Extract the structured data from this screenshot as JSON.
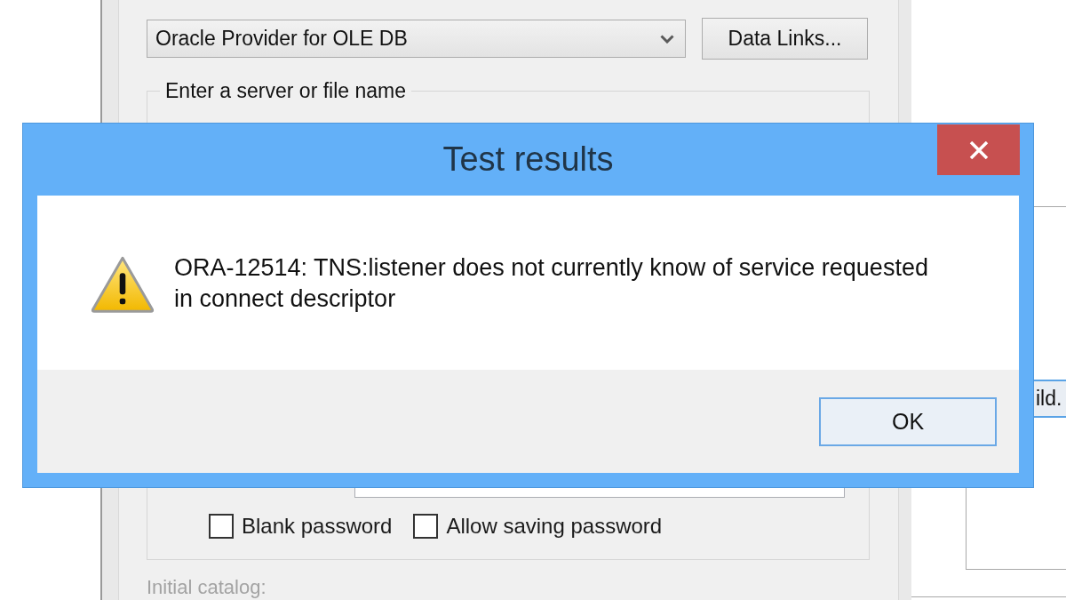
{
  "background_window": {
    "provider_combo": {
      "value": "Oracle Provider for OLE DB"
    },
    "data_links_button": {
      "label": "Data Links..."
    },
    "server_group": {
      "label": "Enter a server or file name"
    },
    "checkboxes": [
      {
        "label": "Blank password",
        "checked": false
      },
      {
        "label": "Allow saving password",
        "checked": false
      }
    ],
    "initial_catalog": {
      "label": "Initial catalog:",
      "disabled": true
    }
  },
  "side_window": {
    "button": {
      "label": "ild."
    }
  },
  "dialog": {
    "title": "Test results",
    "message": "ORA-12514: TNS:listener does not currently know of service requested in connect descriptor",
    "buttons": [
      {
        "label": "OK"
      }
    ]
  }
}
